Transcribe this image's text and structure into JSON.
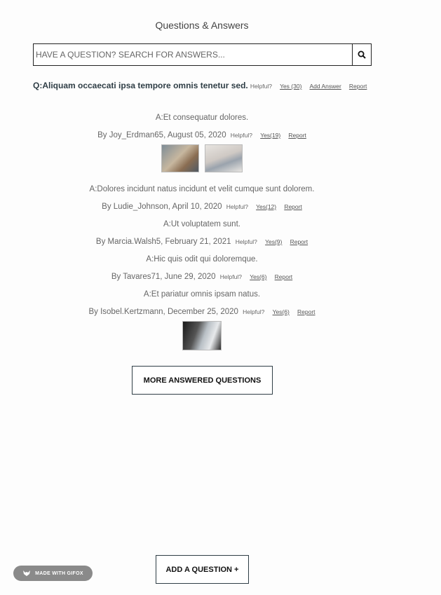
{
  "page_title": "Questions & Answers",
  "search": {
    "placeholder": "HAVE A QUESTION? SEARCH FOR ANSWERS..."
  },
  "question": {
    "text": "Q:Aliquam occaecati ipsa tempore omnis tenetur sed.",
    "helpful_label": "Helpful?",
    "yes_label": "Yes (30)",
    "add_answer_label": "Add Answer",
    "report_label": "Report"
  },
  "answers": [
    {
      "body": "A:Et consequatur dolores.",
      "meta": "By Joy_Erdman65, August 05, 2020",
      "helpful": "Helpful?",
      "yes": "Yes(19)",
      "report": "Report",
      "photos": [
        "photo-1",
        "photo-2"
      ]
    },
    {
      "body": "A:Dolores incidunt natus incidunt et velit cumque sunt dolorem.",
      "meta": "By Ludie_Johnson, April 10, 2020",
      "helpful": "Helpful?",
      "yes": "Yes(12)",
      "report": "Report"
    },
    {
      "body": "A:Ut voluptatem sunt.",
      "meta": "By Marcia.Walsh5, February 21, 2021",
      "helpful": "Helpful?",
      "yes": "Yes(9)",
      "report": "Report"
    },
    {
      "body": "A:Hic quis odit qui doloremque.",
      "meta": "By Tavares71, June 29, 2020",
      "helpful": "Helpful?",
      "yes": "Yes(6)",
      "report": "Report"
    },
    {
      "body": "A:Et pariatur omnis ipsam natus.",
      "meta": "By Isobel.Kertzmann, December 25, 2020",
      "helpful": "Helpful?",
      "yes": "Yes(6)",
      "report": "Report",
      "photos": [
        "photo-3"
      ]
    }
  ],
  "buttons": {
    "more_questions": "MORE ANSWERED QUESTIONS",
    "add_question": "ADD A QUESTION +"
  },
  "watermark": "MADE WITH GIFOX"
}
